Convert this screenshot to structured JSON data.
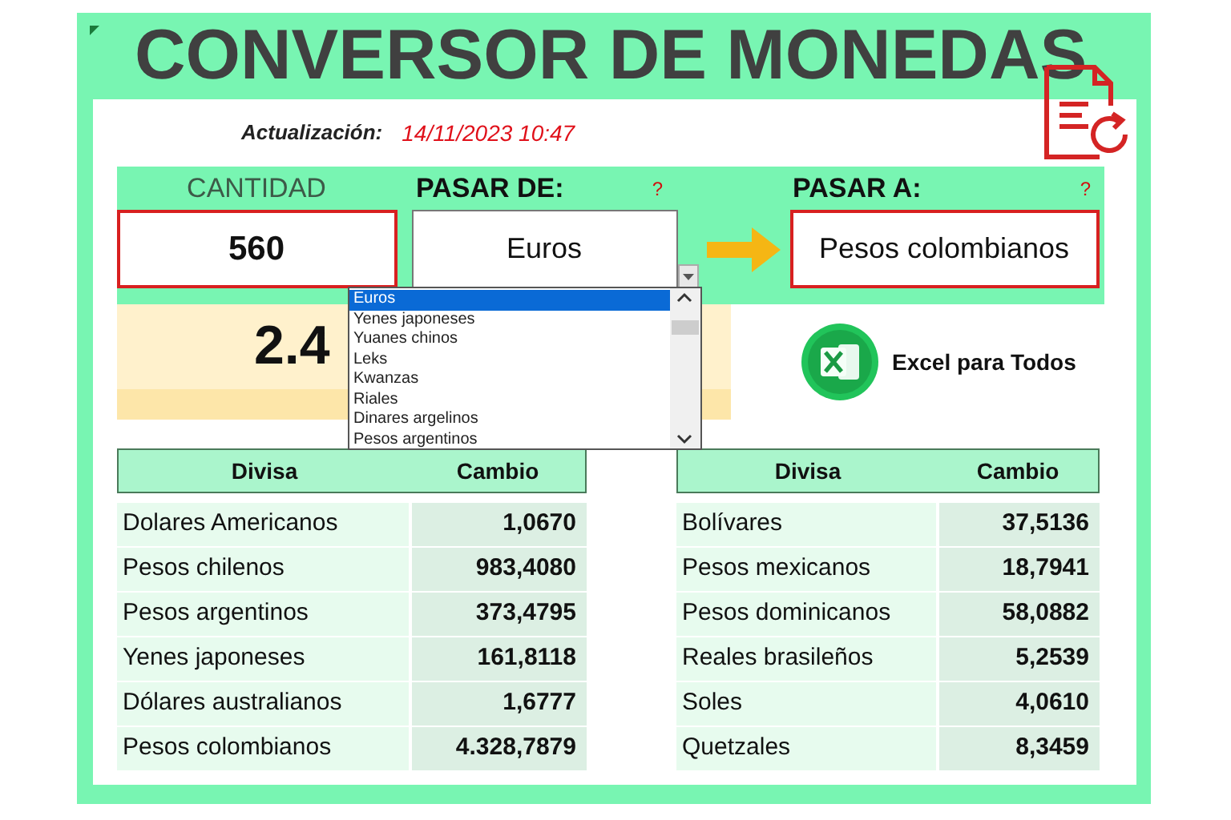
{
  "title": "CONVERSOR DE MONEDAS",
  "update": {
    "label": "Actualización:",
    "value": "14/11/2023 10:47"
  },
  "converter": {
    "amount_label": "CANTIDAD",
    "from_label": "PASAR DE:",
    "from_help": "?",
    "to_label": "PASAR A:",
    "to_help": "?",
    "amount": "560",
    "from": "Euros",
    "to": "Pesos colombianos",
    "result": "2.4"
  },
  "dropdown": {
    "items": [
      {
        "label": "Euros",
        "selected": true
      },
      {
        "label": "Yenes japoneses",
        "selected": false
      },
      {
        "label": "Yuanes chinos",
        "selected": false
      },
      {
        "label": "Leks",
        "selected": false
      },
      {
        "label": "Kwanzas",
        "selected": false
      },
      {
        "label": "Riales",
        "selected": false
      },
      {
        "label": "Dinares argelinos",
        "selected": false
      },
      {
        "label": "Pesos argentinos",
        "selected": false
      }
    ]
  },
  "brand": "Excel para Todos",
  "tables": [
    {
      "columns": [
        "Divisa",
        "Cambio"
      ],
      "rows": [
        [
          "Dolares Americanos",
          "1,0670"
        ],
        [
          "Pesos chilenos",
          "983,4080"
        ],
        [
          "Pesos argentinos",
          "373,4795"
        ],
        [
          "Yenes japoneses",
          "161,8118"
        ],
        [
          "Dólares australianos",
          "1,6777"
        ],
        [
          "Pesos colombianos",
          "4.328,7879"
        ]
      ]
    },
    {
      "columns": [
        "Divisa",
        "Cambio"
      ],
      "rows": [
        [
          "Bolívares",
          "37,5136"
        ],
        [
          "Pesos mexicanos",
          "18,7941"
        ],
        [
          "Pesos dominicanos",
          "58,0882"
        ],
        [
          "Reales brasileños",
          "5,2539"
        ],
        [
          "Soles",
          "4,0610"
        ],
        [
          "Quetzales",
          "8,3459"
        ]
      ]
    }
  ]
}
